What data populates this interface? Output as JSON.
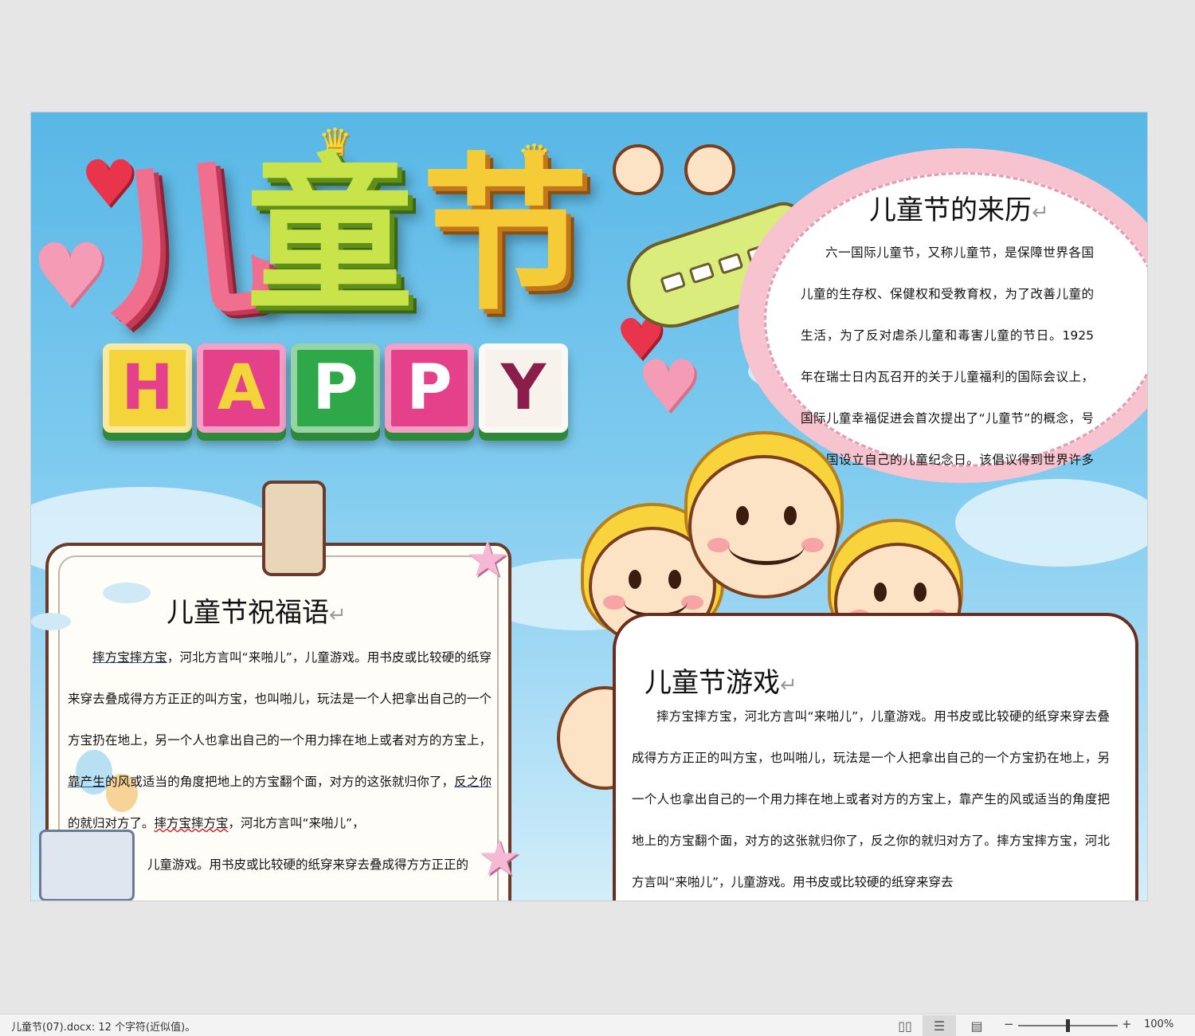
{
  "document": {
    "title_art": {
      "characters": [
        "儿",
        "童",
        "节"
      ],
      "happy_letters": [
        "H",
        "A",
        "P",
        "P",
        "Y"
      ],
      "happy_colors": [
        "#f3d43a",
        "#e5408a",
        "#2fa84a",
        "#e5408a",
        "#f7f2ec"
      ],
      "happy_text_colors": [
        "#e5408a",
        "#f3d43a",
        "#ffffff",
        "#ffffff",
        "#8b1d4a"
      ]
    },
    "history": {
      "title": "儿童节的来历",
      "para_mark": "↵",
      "paragraphs": [
        "六一国际儿童节，又称儿童节，是保障世界各国儿童的生存权、保健权和受教育权，为了改善儿童的生活，为了反对虐杀儿童和毒害儿童的节日。1925 年在瑞士日内瓦召开的关于儿童福利的国际会议上，国际儿童幸福促进会首次提出了“儿童节”的概念，号召各国设立自己的儿童纪念日。该倡议得到世界许多国家的赞同。之后，数国家逐渐定为"
      ]
    },
    "wishes": {
      "title": "儿童节祝福语",
      "para_mark": "↵",
      "p1_a": "摔方宝摔方宝",
      "p1_b": "，河北方言叫“来啪儿”，儿童游戏。用书皮或比较硬的纸穿来穿去叠成得方方正正的叫方宝，也叫啪儿，玩法是一个人把拿出自己的一个方宝扔在地上，另一个人也拿出自己的一个用力摔在地上或者对方的方宝上，",
      "p1_c": "靠产生",
      "p1_d": "的风或适当的角度把地上的方宝翻个面，对方的这张就归你了，",
      "p1_e": "反之你",
      "p1_f": "的就归对方了。",
      "p1_g": "摔方宝摔方宝",
      "p1_h": "，河北方言叫“来啪儿”，",
      "p2": "儿童游戏。用书皮或比较硬的纸穿来穿去叠成得方方正正的"
    },
    "games": {
      "title": "儿童节游戏",
      "para_mark": "↵",
      "paragraphs": [
        "摔方宝摔方宝，河北方言叫“来啪儿”，儿童游戏。用书皮或比较硬的纸穿来穿去叠成得方方正正的叫方宝，也叫啪儿，玩法是一个人把拿出自己的一个方宝扔在地上，另一个人也拿出自己的一个用力摔在地上或者对方的方宝上，靠产生的风或适当的角度把地上的方宝翻个面，对方的这张就归你了，反之你的就归对方了。摔方宝摔方宝，河北方言叫“来啪儿”，儿童游戏。用书皮或比较硬的纸穿来穿去"
      ]
    }
  },
  "status_bar": {
    "doc_info": "儿童节(07).docx: 12 个字符(近似值)。",
    "zoom_minus": "−",
    "zoom_plus": "+",
    "zoom_level": "100%",
    "read_mode_icon": "read-mode-icon",
    "print_layout_icon": "print-layout-icon",
    "web_layout_icon": "web-layout-icon"
  },
  "colors": {
    "sky": "#58b7e6",
    "history_ring": "#f6c3cf",
    "card_border": "#6b3a2a"
  }
}
